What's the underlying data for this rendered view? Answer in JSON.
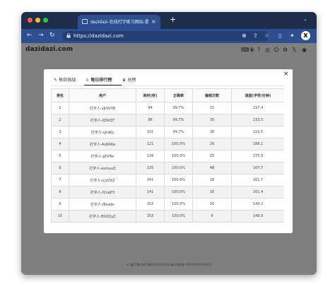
{
  "browser": {
    "tab_title": "dazidazi-在线打字练习网站-提高",
    "tab_close": "×",
    "new_tab": "+",
    "tab_menu": "⌄",
    "url": "https://dazidazi.com",
    "back": "←",
    "forward": "→",
    "reload": "↻",
    "profile_letter": "X"
  },
  "site": {
    "brand": "dazidazi.com",
    "footer": "© 赣ICP备 京ICP备2023012号号 赣公网安备 36XXXXXXXXXX号"
  },
  "modal": {
    "close": "×",
    "tabs": [
      {
        "label": "每日挑战",
        "icon": "✎"
      },
      {
        "label": "每日排行榜",
        "icon": "♕"
      },
      {
        "label": "总榜",
        "icon": "♛"
      }
    ],
    "active_tab": 1,
    "table": {
      "headers": [
        "排名",
        "用户",
        "耗时(秒)",
        "正确率",
        "输错次数",
        "速度(字符/分钟)"
      ],
      "rows": [
        [
          "1",
          "打字人-yK4VYB",
          "94",
          "99.7%",
          "15",
          "237.4"
        ],
        [
          "2",
          "打字人-XEAI3T",
          "96",
          "99.7%",
          "35",
          "233.5"
        ],
        [
          "3",
          "打字人-vJraKc",
          "101",
          "99.7%",
          "30",
          "222.0"
        ],
        [
          "4",
          "打字人-4v6RRa",
          "121",
          "100.0%",
          "26",
          "188.1"
        ],
        [
          "5",
          "打字人-gFVTei",
          "129",
          "100.0%",
          "25",
          "175.9"
        ],
        [
          "6",
          "打字人-eomuxZ",
          "135",
          "100.0%",
          "48",
          "167.7"
        ],
        [
          "7",
          "打字人-jcjzZXZ",
          "141",
          "100.0%",
          "18",
          "161.7"
        ],
        [
          "8",
          "打字人-f2uqP3",
          "141",
          "100.0%",
          "16",
          "161.4"
        ],
        [
          "9",
          "打字人-f8owbr",
          "152",
          "100.0%",
          "16",
          "149.2"
        ],
        [
          "10",
          "打字人-E0QOyZ",
          "153",
          "100.0%",
          "9",
          "148.9"
        ]
      ]
    }
  }
}
